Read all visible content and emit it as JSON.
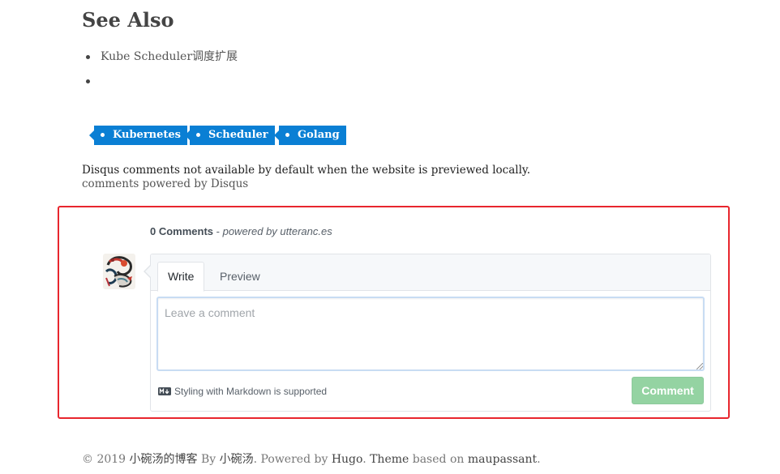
{
  "see_also": {
    "title": "See Also",
    "items": [
      {
        "label": "Kube Scheduler调度扩展"
      },
      {
        "label": ""
      }
    ]
  },
  "tags": [
    {
      "label": "Kubernetes"
    },
    {
      "label": "Scheduler"
    },
    {
      "label": "Golang"
    }
  ],
  "disqus": {
    "note": "Disqus comments not available by default when the website is previewed locally.",
    "powered": "comments powered by Disqus"
  },
  "utterances": {
    "count_label": "0 Comments",
    "separator": " - ",
    "powered_by": "powered by utteranc.es",
    "tabs": [
      {
        "label": "Write",
        "active": true
      },
      {
        "label": "Preview",
        "active": false
      }
    ],
    "textarea_placeholder": "Leave a comment",
    "textarea_value": "",
    "markdown_hint": "Styling with Markdown is supported",
    "comment_button": "Comment",
    "button_color": "#94d3a2"
  },
  "footer": {
    "copyright": "© 2019 ",
    "site_name": "小碗汤的博客",
    "by": " By ",
    "author": "小碗汤",
    "powered_text": ". Powered by ",
    "hugo": "Hugo",
    "dot": ". ",
    "theme": "Theme",
    "based_on": " based on ",
    "maupassant": "maupassant",
    "end": "."
  },
  "colors": {
    "tag_bg": "#0a7fd4",
    "highlight_border": "#e8262e"
  }
}
